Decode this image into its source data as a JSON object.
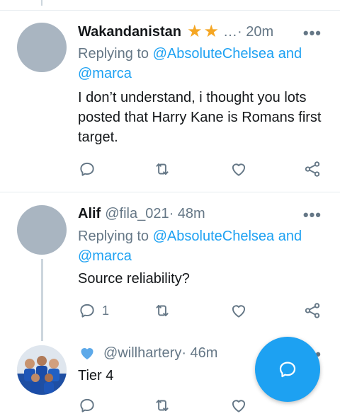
{
  "tweets": [
    {
      "name": "Wakandanistan",
      "badges": "… ",
      "time": "· 20m",
      "replying_prefix": "Replying to ",
      "mention1": "@AbsoluteChelsea and",
      "mention2": "@marca",
      "text": "I don’t understand, i thought you lots posted that Harry Kane is Romans first target.",
      "more": "•••"
    },
    {
      "name": "Alif",
      "handle": "@fila_021",
      "time": " · 48m",
      "replying_prefix": "Replying to ",
      "mention1": "@AbsoluteChelsea and",
      "mention2": "@marca",
      "text": "Source reliability?",
      "reply_count": "1",
      "more": "•••"
    },
    {
      "handle": "@willhartery",
      "time": " · 46m",
      "text": "Tier 4"
    }
  ],
  "icons": {
    "reply": "reply-icon",
    "retweet": "retweet-icon",
    "like": "heart-icon",
    "share": "share-icon",
    "compose": "compose-reply-icon"
  },
  "colors": {
    "accent": "#1da1f2",
    "secondary_text": "#657786",
    "star": "#f5a623"
  }
}
